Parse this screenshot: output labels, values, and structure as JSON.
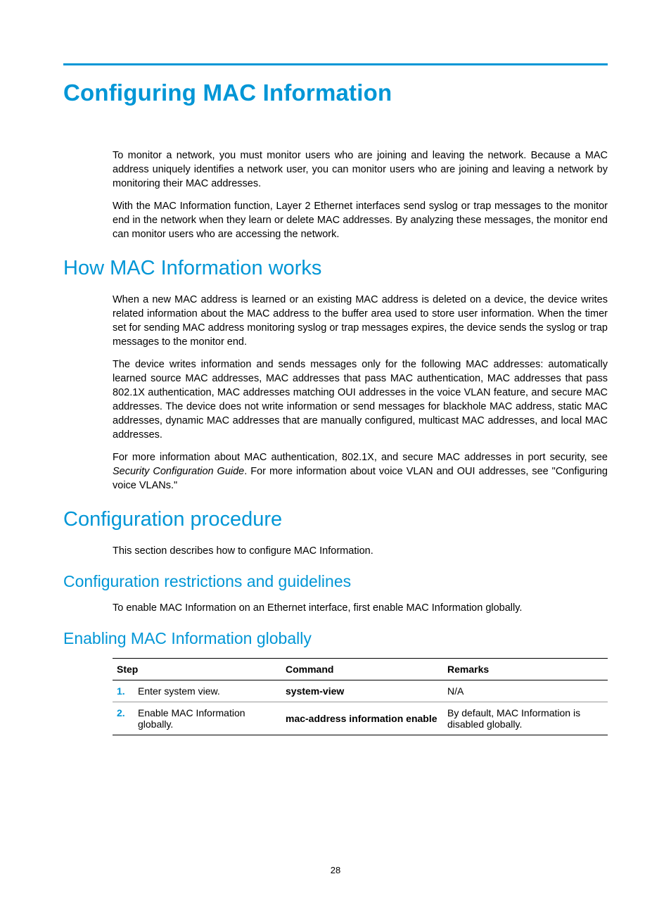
{
  "title": "Configuring MAC Information",
  "intro": {
    "p1": "To monitor a network, you must monitor users who are joining and leaving the network. Because a MAC address uniquely identifies a network user, you can monitor users who are joining and leaving a network by monitoring their MAC addresses.",
    "p2": "With the MAC Information function, Layer 2 Ethernet interfaces send syslog or trap messages to the monitor end in the network when they learn or delete MAC addresses. By analyzing these messages, the monitor end can monitor users who are accessing the network."
  },
  "how": {
    "heading": "How MAC Information works",
    "p1": "When a new MAC address is learned or an existing MAC address is deleted on a device, the device writes related information about the MAC address to the buffer area used to store user information. When the timer set for sending MAC address monitoring syslog or trap messages expires, the device sends the syslog or trap messages to the monitor end.",
    "p2": "The device writes information and sends messages only for the following MAC addresses: automatically learned source MAC addresses, MAC addresses that pass MAC authentication, MAC addresses that pass 802.1X authentication, MAC addresses matching OUI addresses in the voice VLAN feature, and secure MAC addresses. The device does not write information or send messages for blackhole MAC address, static MAC addresses, dynamic MAC addresses that are manually configured, multicast MAC addresses, and local MAC addresses.",
    "p3a": "For more information about MAC authentication, 802.1X, and secure MAC addresses in port security, see ",
    "p3i": "Security Configuration Guide",
    "p3b": ". For more information about voice VLAN and OUI addresses, see \"Configuring voice VLANs.\""
  },
  "proc": {
    "heading": "Configuration procedure",
    "p1": "This section describes how to configure MAC Information."
  },
  "restrict": {
    "heading": "Configuration restrictions and guidelines",
    "p1": "To enable MAC Information on an Ethernet interface, first enable MAC Information globally."
  },
  "enable": {
    "heading": "Enabling MAC Information globally",
    "table": {
      "headers": {
        "step": "Step",
        "command": "Command",
        "remarks": "Remarks"
      },
      "rows": [
        {
          "num": "1.",
          "step": "Enter system view.",
          "command": "system-view",
          "remarks": "N/A"
        },
        {
          "num": "2.",
          "step": "Enable MAC Information globally.",
          "command": "mac-address information enable",
          "remarks": "By default, MAC Information is disabled globally."
        }
      ]
    }
  },
  "page_number": "28"
}
